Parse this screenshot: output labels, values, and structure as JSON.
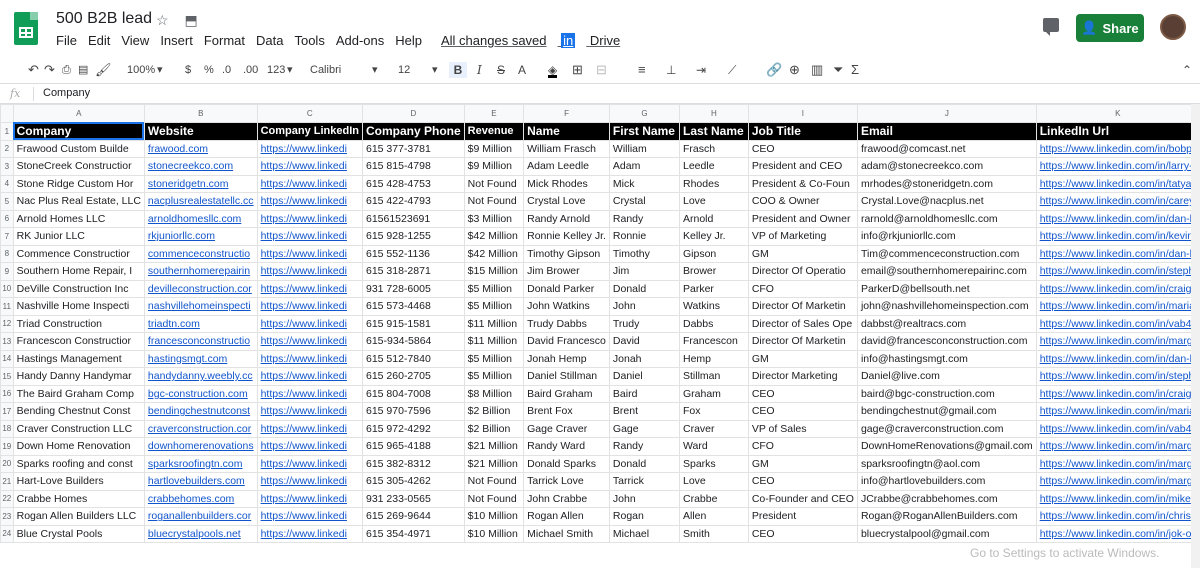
{
  "app": {
    "doc_title": "500 B2B lead",
    "menus": [
      "File",
      "Edit",
      "View",
      "Insert",
      "Format",
      "Data",
      "Tools",
      "Add-ons",
      "Help"
    ],
    "saved_text": "All changes saved",
    "saved_in": "in",
    "saved_drive": "Drive",
    "share_label": "Share"
  },
  "toolbar": {
    "zoom": "100%",
    "currency": "$",
    "percent": "%",
    "dec_less": ".0",
    "dec_more": ".00",
    "format_num": "123",
    "font": "Calibri",
    "font_size": "12",
    "bold": "B",
    "italic": "I",
    "strike": "S",
    "text_color": "A"
  },
  "formula_bar": {
    "fx": "fx",
    "value": "Company"
  },
  "columns": [
    "A",
    "B",
    "C",
    "D",
    "E",
    "F",
    "G",
    "H",
    "I",
    "J",
    "K"
  ],
  "headers": [
    "Company",
    "Website",
    "Company LinkedIn",
    "Company Phone",
    "Revenue",
    "Name",
    "First Name",
    "Last Name",
    "Job Title",
    "Email",
    "LinkedIn Url"
  ],
  "rows": [
    {
      "n": "2",
      "c": [
        "Frawood Custom Builde",
        "frawood.com",
        "https://www.linkedi",
        "615 377-3781",
        "$9 Million",
        "William Frasch",
        "William",
        "Frasch",
        "CEO",
        "frawood@comcast.net",
        "https://www.linkedin.com/in/bobp"
      ]
    },
    {
      "n": "3",
      "c": [
        "StoneCreek Constructior",
        "stonecreekco.com",
        "https://www.linkedi",
        "615 815-4798",
        "$9 Million",
        "Adam Leedle",
        "Adam",
        "Leedle",
        "President and CEO",
        "adam@stonecreekco.com",
        "https://www.linkedin.com/in/larry-"
      ]
    },
    {
      "n": "4",
      "c": [
        "Stone Ridge Custom Hor",
        "stoneridgetn.com",
        "https://www.linkedi",
        "615 428-4753",
        "Not Found",
        "Mick Rhodes",
        "Mick",
        "Rhodes",
        "President & Co-Foun",
        "mrhodes@stoneridgetn.com",
        "https://www.linkedin.com/in/tatya"
      ]
    },
    {
      "n": "5",
      "c": [
        "Nac Plus Real Estate, LLC",
        "nacplusrealestatellc.cc",
        "https://www.linkedi",
        "615 422-4793",
        "Not Found",
        "Crystal Love",
        "Crystal",
        "Love",
        "COO & Owner",
        "Crystal.Love@nacplus.net",
        "https://www.linkedin.com/in/carey"
      ]
    },
    {
      "n": "6",
      "c": [
        "Arnold Homes LLC",
        "arnoldhomesllc.com",
        "https://www.linkedi",
        "61561523691",
        "$3 Million",
        "Randy Arnold",
        "Randy",
        "Arnold",
        "President and Owner",
        "rarnold@arnoldhomesllc.com",
        "https://www.linkedin.com/in/dan-l"
      ]
    },
    {
      "n": "7",
      "c": [
        "RK Junior LLC",
        "rkjuniorllc.com",
        "https://www.linkedi",
        "615 928-1255",
        "$42 Million",
        "Ronnie Kelley Jr.",
        "Ronnie",
        "Kelley Jr.",
        "VP of Marketing",
        "info@rkjuniorllc.com",
        "https://www.linkedin.com/in/kevin"
      ]
    },
    {
      "n": "8",
      "c": [
        "Commence Constructior",
        "commenceconstructio",
        "https://www.linkedi",
        "615 552-1136",
        "$42 Million",
        "Timothy Gipson",
        "Timothy",
        "Gipson",
        "GM",
        "Tim@commenceconstruction.com",
        "https://www.linkedin.com/in/dan-l"
      ]
    },
    {
      "n": "9",
      "c": [
        "Southern Home Repair, I",
        "southernhomerepairin",
        "https://www.linkedi",
        "615 318-2871",
        "$15 Million",
        "Jim Brower",
        "Jim",
        "Brower",
        "Director Of Operatio",
        "email@southernhomerepairinc.com",
        "https://www.linkedin.com/in/steph"
      ]
    },
    {
      "n": "10",
      "c": [
        "DeVille Construction Inc",
        "devilleconstruction.cor",
        "https://www.linkedi",
        "931 728-6005",
        "$5 Million",
        "Donald Parker",
        "Donald",
        "Parker",
        "CFO",
        "ParkerD@bellsouth.net",
        "https://www.linkedin.com/in/craig-"
      ]
    },
    {
      "n": "11",
      "c": [
        "Nashville Home Inspecti",
        "nashvillehomeinspecti",
        "https://www.linkedi",
        "615 573-4468",
        "$5 Million",
        "John Watkins",
        "John",
        "Watkins",
        "Director Of Marketin",
        "john@nashvillehomeinspection.com",
        "https://www.linkedin.com/in/maria"
      ]
    },
    {
      "n": "12",
      "c": [
        "Triad Construction",
        "triadtn.com",
        "https://www.linkedi",
        "615 915-1581",
        "$11 Million",
        "Trudy Dabbs",
        "Trudy",
        "Dabbs",
        "Director of Sales Ope",
        "dabbst@realtracs.com",
        "https://www.linkedin.com/in/vab4"
      ]
    },
    {
      "n": "13",
      "c": [
        "Francescon Constructior",
        "francesconconstructio",
        "https://www.linkedi",
        "615-934-5864",
        "$11 Million",
        "David Francesco",
        "David",
        "Francescon",
        "Director Of Marketin",
        "david@francesconconstruction.com",
        "https://www.linkedin.com/in/marg"
      ]
    },
    {
      "n": "14",
      "c": [
        "Hastings Management",
        "hastingsmgt.com",
        "https://www.linkedi",
        "615 512-7840",
        "$5 Million",
        "Jonah Hemp",
        "Jonah",
        "Hemp",
        "GM",
        "info@hastingsmgt.com",
        "https://www.linkedin.com/in/dan-l"
      ]
    },
    {
      "n": "15",
      "c": [
        "Handy Danny Handymar",
        "handydanny.weebly.cc",
        "https://www.linkedi",
        "615 260-2705",
        "$5 Million",
        "Daniel Stillman",
        "Daniel",
        "Stillman",
        "Director Marketing",
        "Daniel@live.com",
        "https://www.linkedin.com/in/steph"
      ]
    },
    {
      "n": "16",
      "c": [
        "The Baird Graham Comp",
        "bgc-construction.com",
        "https://www.linkedi",
        "615 804-7008",
        "$8 Million",
        "Baird Graham",
        "Baird",
        "Graham",
        "CEO",
        "baird@bgc-construction.com",
        "https://www.linkedin.com/in/craig-"
      ]
    },
    {
      "n": "17",
      "c": [
        "Bending Chestnut Const",
        "bendingchestnutconst",
        "https://www.linkedi",
        "615 970-7596",
        "$2 Billion",
        "Brent Fox",
        "Brent",
        "Fox",
        "CEO",
        "bendingchestnut@gmail.com",
        "https://www.linkedin.com/in/maria"
      ]
    },
    {
      "n": "18",
      "c": [
        "Craver Construction LLC",
        "craverconstruction.cor",
        "https://www.linkedi",
        "615 972-4292",
        "$2 Billion",
        "Gage Craver",
        "Gage",
        "Craver",
        "VP of Sales",
        "gage@craverconstruction.com",
        "https://www.linkedin.com/in/vab4"
      ]
    },
    {
      "n": "19",
      "c": [
        "Down Home Renovation",
        "downhomerenovations",
        "https://www.linkedi",
        "615 965-4188",
        "$21 Million",
        "Randy Ward",
        "Randy",
        "Ward",
        "CFO",
        "DownHomeRenovations@gmail.com",
        "https://www.linkedin.com/in/marg"
      ]
    },
    {
      "n": "20",
      "c": [
        "Sparks roofing and const",
        "sparksroofingtn.com",
        "https://www.linkedi",
        "615 382-8312",
        "$21 Million",
        "Donald Sparks",
        "Donald",
        "Sparks",
        "GM",
        "sparksroofingtn@aol.com",
        "https://www.linkedin.com/in/marg"
      ]
    },
    {
      "n": "21",
      "c": [
        "Hart-Love Builders",
        "hartlovebuilders.com",
        "https://www.linkedi",
        "615 305-4262",
        "Not Found",
        "Tarrick Love",
        "Tarrick",
        "Love",
        "CEO",
        "info@hartlovebuilders.com",
        "https://www.linkedin.com/in/marg"
      ]
    },
    {
      "n": "22",
      "c": [
        "Crabbe Homes",
        "crabbehomes.com",
        "https://www.linkedi",
        "931 233-0565",
        "Not Found",
        "John Crabbe",
        "John",
        "Crabbe",
        "Co-Founder and CEO",
        "JCrabbe@crabbehomes.com",
        "https://www.linkedin.com/in/mike"
      ]
    },
    {
      "n": "23",
      "c": [
        "Rogan Allen Builders LLC",
        "roganallenbuilders.cor",
        "https://www.linkedi",
        "615 269-9644",
        "$10 Million",
        "Rogan Allen",
        "Rogan",
        "Allen",
        "President",
        "Rogan@RoganAllenBuilders.com",
        "https://www.linkedin.com/in/chris"
      ]
    },
    {
      "n": "24",
      "c": [
        "Blue Crystal Pools",
        "bluecrystalpools.net",
        "https://www.linkedi",
        "615 354-4971",
        "$10 Million",
        "Michael Smith",
        "Michael",
        "Smith",
        "CEO",
        "bluecrystalpool@gmail.com",
        "https://www.linkedin.com/in/jok-o"
      ]
    }
  ],
  "watermark": "Go to Settings to activate Windows."
}
